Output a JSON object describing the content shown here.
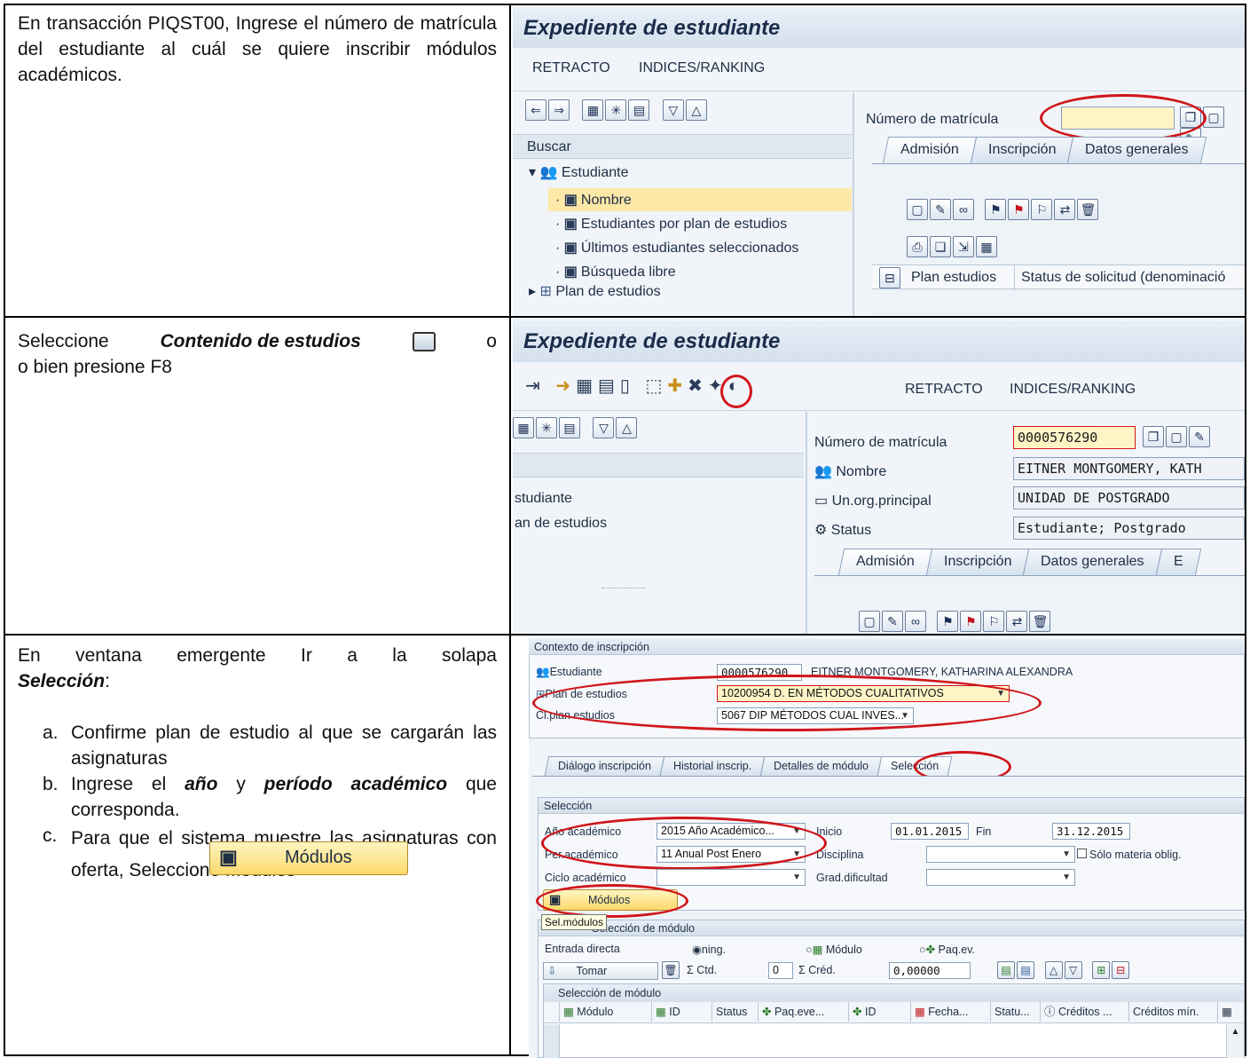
{
  "row1": {
    "instruction": "En transacción PIQST00, Ingrese el número de matrícula del estudiante al cuál se quiere inscribir módulos académicos.",
    "screen": {
      "title": "Expediente de estudiante",
      "menu": [
        "RETRACTO",
        "INDICES/RANKING"
      ],
      "search_label": "Buscar",
      "tree": {
        "root": "Estudiante",
        "items": [
          "Nombre",
          "Estudiantes por plan de estudios",
          "Últimos estudiantes seleccionados",
          "Búsqueda libre"
        ],
        "sibling": "Plan de estudios"
      },
      "field_label": "Número de matrícula",
      "field_value": "",
      "tabs": [
        "Admisión",
        "Inscripción",
        "Datos generales"
      ],
      "table_headers": [
        "Plan estudios",
        "Status de solicitud (denominació"
      ]
    }
  },
  "row2": {
    "instruction_pre": "Seleccione",
    "instruction_em": "Contenido de estudios",
    "instruction_post": "o bien presione F8",
    "screen": {
      "title": "Expediente de estudiante",
      "menu": [
        "RETRACTO",
        "INDICES/RANKING"
      ],
      "tree_items": [
        "studiante",
        "an de estudios"
      ],
      "fields": [
        {
          "label": "Número de matrícula",
          "value": "0000576290"
        },
        {
          "label": "Nombre",
          "value": "EITNER MONTGOMERY, KATH"
        },
        {
          "label": "Un.org.principal",
          "value": "UNIDAD DE POSTGRADO"
        },
        {
          "label": "Status",
          "value": "Estudiante; Postgrado"
        }
      ],
      "tabs": [
        "Admisión",
        "Inscripción",
        "Datos generales",
        "E"
      ]
    }
  },
  "row3": {
    "intro_pre": "En ventana emergente Ir a la solapa",
    "intro_em": "Selección",
    "intro_post": ":",
    "steps": [
      {
        "marker": "a.",
        "text": "Confirme plan de estudio al que se cargarán las asignaturas"
      },
      {
        "marker": "b.",
        "pre": "Ingrese el",
        "em1": "año",
        "mid": "y",
        "em2": "período académico",
        "post": "que corresponda."
      },
      {
        "marker": "c.",
        "text": "Para que el sistema muestre las asignaturas con oferta, Seleccione Módulos"
      }
    ],
    "button_label": "Módulos",
    "screen": {
      "context_header": "Contexto de inscripción",
      "student_label": "Estudiante",
      "student_id": "0000576290",
      "student_name": "EITNER MONTGOMERY, KATHARINA ALEXANDRA",
      "plan_label": "Plan de estudios",
      "plan_value": "10200954 D. EN MÉTODOS CUALITATIVOS",
      "clplan_label": "Cl.plan estudios",
      "clplan_value": "5067 DIP MÉTODOS CUAL INVES...",
      "tabs": [
        "Diálogo inscripción",
        "Historial inscrip.",
        "Detalles de módulo",
        "Selección"
      ],
      "sel_header": "Selección",
      "anio_label": "Año académico",
      "anio_value": "2015 Año Académico...",
      "inicio_label": "Inicio",
      "inicio_value": "01.01.2015",
      "fin_label": "Fin",
      "fin_value": "31.12.2015",
      "per_label": "Per.académico",
      "per_value": "11 Anual Post Enero",
      "disc_label": "Disciplina",
      "solo_label": "Sólo materia oblig.",
      "ciclo_label": "Ciclo académico",
      "grad_label": "Grad.dificultad",
      "modulos_btn": "Módulos",
      "tooltip": "Sel.módulos",
      "selmod_header": "Selección de módulo",
      "entrada_label": "Entrada directa",
      "radio_ning": "ning.",
      "radio_modulo": "Módulo",
      "radio_paq": "Paq.ev.",
      "tomar": "Tomar",
      "ctd": "Ctd.",
      "ctd_value": "0",
      "cred": "Créd.",
      "cred_value": "0,00000",
      "table_title": "Selección de módulo",
      "columns": [
        "Módulo",
        "ID",
        "Status",
        "Paq.eve...",
        "ID",
        "Fecha...",
        "Statu...",
        "Créditos ...",
        "Créditos mín."
      ]
    }
  }
}
